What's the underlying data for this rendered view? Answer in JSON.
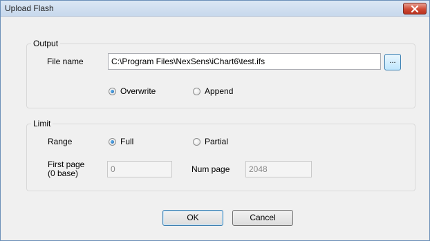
{
  "window": {
    "title": "Upload Flash"
  },
  "output": {
    "legend": "Output",
    "file_name_label": "File name",
    "file_name_value": "C:\\Program Files\\NexSens\\iChart6\\test.ifs",
    "browse_label": "...",
    "overwrite_label": "Overwrite",
    "append_label": "Append",
    "selected": "Overwrite"
  },
  "limit": {
    "legend": "Limit",
    "range_label": "Range",
    "full_label": "Full",
    "partial_label": "Partial",
    "selected": "Full",
    "first_page_label_line1": "First page",
    "first_page_label_line2": "(0 base)",
    "first_page_value": "0",
    "num_page_label": "Num page",
    "num_page_value": "2048"
  },
  "buttons": {
    "ok": "OK",
    "cancel": "Cancel"
  }
}
